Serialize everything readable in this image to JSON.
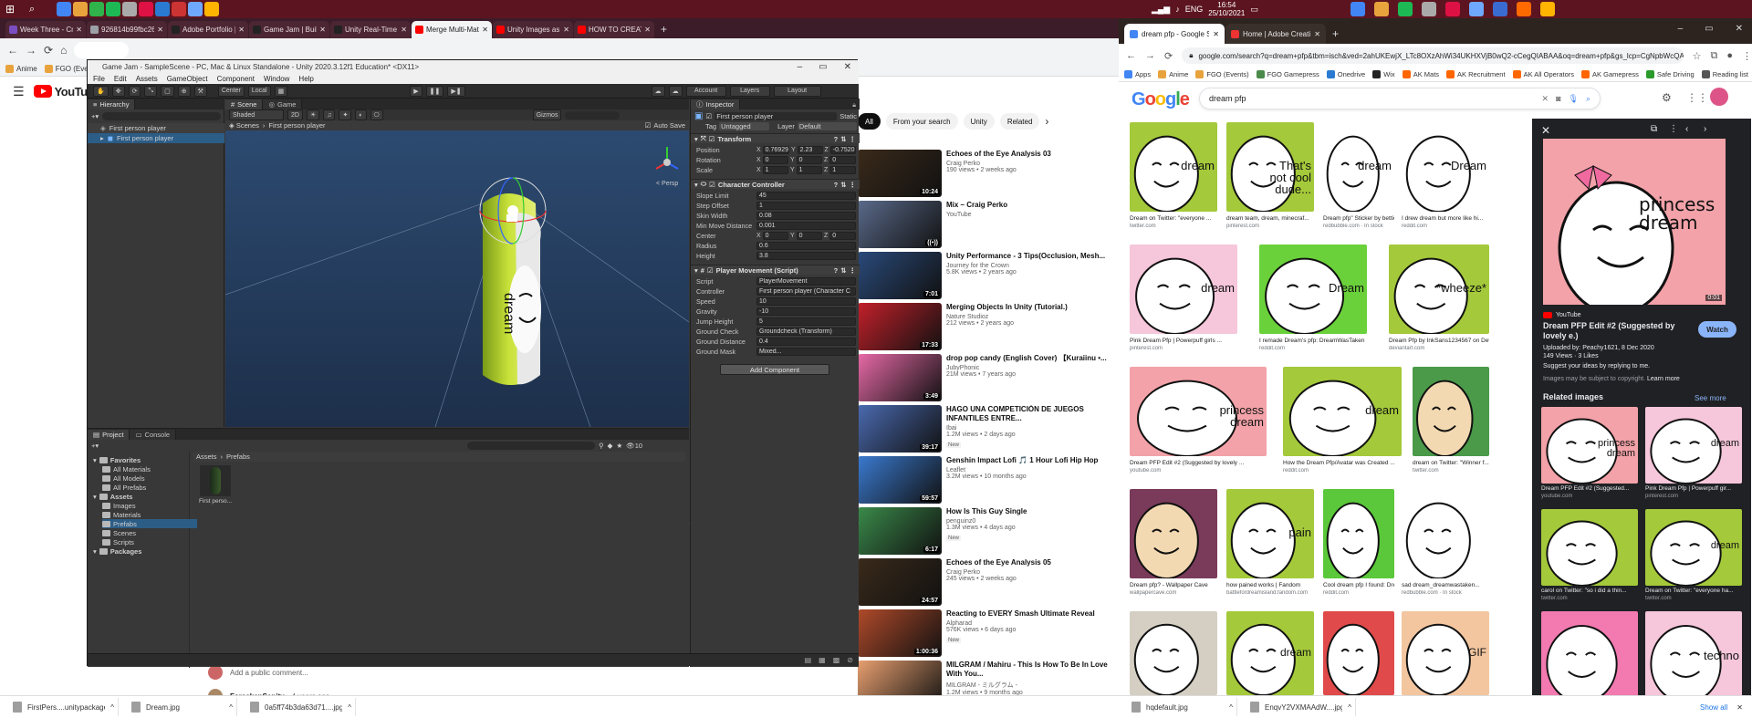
{
  "taskbar": {
    "time": "16:54",
    "date": "25/10/2021",
    "lang": "ENG"
  },
  "left_browser": {
    "tabs": [
      {
        "label": "Week Three - Creating 3D envi",
        "color": "#7a4ec1"
      },
      {
        "label": "926814b99fbc262ec8954b4354",
        "color": "#9aa0a6"
      },
      {
        "label": "Adobe Portfolio | Build your ow",
        "color": "#222"
      },
      {
        "label": "Game Jam | Build History - Clou",
        "color": "#222"
      },
      {
        "label": "Unity Real-Time Development Pl",
        "color": "#222"
      },
      {
        "label": "Merge Multi-Material Meshes in",
        "color": "#f00",
        "active": true
      },
      {
        "label": "Unity Images as Textures and M",
        "color": "#f00"
      },
      {
        "label": "HOW TO CREATE A TRUE MIRRO",
        "color": "#f00"
      }
    ],
    "new_tab": "+",
    "bookmarks": [
      "Anime",
      "FGO (Events)"
    ],
    "downloads": [
      "FirstPers....unitypackage",
      "Dream.jpg",
      "0a5ff74b3da63d71....jpg"
    ]
  },
  "youtube": {
    "logo": "YouTube",
    "chips": [
      "All",
      "From your search",
      "Unity",
      "Related"
    ],
    "chip_next": "›",
    "recommendations": [
      {
        "title": "Echoes of the Eye Analysis 03",
        "channel": "Craig Perko",
        "stats": "190 views • 2 weeks ago",
        "duration": "10:24",
        "color": "#3a2a1a"
      },
      {
        "title": "Mix – Craig Perko",
        "channel": "YouTube",
        "stats": "",
        "duration": "((•))",
        "color": "#5a6a8a"
      },
      {
        "title": "Unity Performance - 3 Tips(Occlusion, Mesh...",
        "channel": "Journey for the Crown",
        "stats": "5.8K views • 2 years ago",
        "duration": "7:01",
        "color": "#2a4a7a"
      },
      {
        "title": "Merging Objects In Unity (Tutorial.)",
        "channel": "Nature Studioz",
        "stats": "212 views • 2 years ago",
        "duration": "17:33",
        "color": "#c2202a"
      },
      {
        "title": "drop pop candy (English Cover) 【Kuraiinu •...",
        "channel": "JubyPhonic",
        "stats": "21M views • 7 years ago",
        "duration": "3:49",
        "color": "#e86aa8"
      },
      {
        "title": "HAGO UNA COMPETICIÓN DE JUEGOS INFANTILES ENTRE...",
        "channel": "Ibai",
        "stats": "1.2M views • 2 days ago",
        "duration": "39:17",
        "color": "#4a6ab0",
        "new": "New"
      },
      {
        "title": "Genshin Impact Lofi 🎵 1 Hour Lofi Hip Hop",
        "channel": "Leaflet",
        "stats": "3.2M views • 10 months ago",
        "duration": "59:57",
        "color": "#3a7ad0"
      },
      {
        "title": "How Is This Guy Single",
        "channel": "penguinz0",
        "stats": "1.3M views • 4 days ago",
        "duration": "6:17",
        "color": "#3a8a4a",
        "new": "New"
      },
      {
        "title": "Echoes of the Eye Analysis 05",
        "channel": "Craig Perko",
        "stats": "245 views • 2 weeks ago",
        "duration": "24:57",
        "color": "#3a2a1a"
      },
      {
        "title": "Reacting to EVERY Smash Ultimate Reveal",
        "channel": "Alpharad",
        "stats": "576K views • 6 days ago",
        "duration": "1:00:36",
        "color": "#b04a2a",
        "new": "New"
      },
      {
        "title": "MILGRAM / Mahiru - This Is How To Be In Love With You...",
        "channel": "MILGRAM - ミルグラム -",
        "stats": "1.2M views • 9 months ago",
        "duration": "",
        "color": "#e8a070"
      }
    ],
    "add_comment": "Add a public comment...",
    "commenter": "ForsakenSanity",
    "comment_time": "4 years ago"
  },
  "unity": {
    "title": "Game Jam - SampleScene - PC, Mac & Linux Standalone - Unity 2020.3.12f1 Education* <DX11>",
    "menu": [
      "File",
      "Edit",
      "Assets",
      "GameObject",
      "Component",
      "Window",
      "Help"
    ],
    "toolbar": {
      "center": "Center",
      "local": "Local",
      "account": "Account",
      "layers": "Layers",
      "layout": "Layout"
    },
    "hierarchy": {
      "tab": "Hierarchy",
      "items": [
        "First person player",
        "First person player"
      ]
    },
    "scene": {
      "tabs": [
        "Scene",
        "Game"
      ],
      "shading": "Shaded",
      "mode2d": "2D",
      "gizmos": "Gizmos",
      "breadcrumb": [
        "Scenes",
        "First person player"
      ],
      "auto_save": "Auto Save",
      "persp": "< Persp",
      "capsule_text": "dream"
    },
    "inspector": {
      "tab": "Inspector",
      "object_name": "First person player",
      "static": "Static",
      "tag_label": "Tag",
      "tag": "Untagged",
      "layer_label": "Layer",
      "layer": "Default",
      "transform": {
        "header": "Transform",
        "position_label": "Position",
        "position": [
          "0.76929",
          "2.23",
          "-0.7520"
        ],
        "rotation_label": "Rotation",
        "rotation": [
          "0",
          "0",
          "0"
        ],
        "scale_label": "Scale",
        "scale": [
          "1",
          "1",
          "1"
        ]
      },
      "cc": {
        "header": "Character Controller",
        "fields": [
          [
            "Slope Limit",
            "45"
          ],
          [
            "Step Offset",
            "1"
          ],
          [
            "Skin Width",
            "0.08"
          ],
          [
            "Min Move Distance",
            "0.001"
          ]
        ],
        "center_label": "Center",
        "center": [
          "0",
          "0",
          "0"
        ],
        "fields2": [
          [
            "Radius",
            "0.6"
          ],
          [
            "Height",
            "3.8"
          ]
        ]
      },
      "pm": {
        "header": "Player Movement (Script)",
        "fields": [
          [
            "Script",
            "PlayerMovement"
          ],
          [
            "Controller",
            "First person player (Character C"
          ],
          [
            "Speed",
            "10"
          ],
          [
            "Gravity",
            "-10"
          ],
          [
            "Jump Height",
            "5"
          ],
          [
            "Ground Check",
            "Groundcheck (Transform)"
          ],
          [
            "Ground Distance",
            "0.4"
          ],
          [
            "Ground Mask",
            "Mixed..."
          ]
        ]
      },
      "add_component": "Add Component"
    },
    "project": {
      "tabs": [
        "Project",
        "Console"
      ],
      "tree": [
        [
          "Favorites",
          0,
          true
        ],
        [
          "All Materials",
          1,
          false
        ],
        [
          "All Models",
          1,
          false
        ],
        [
          "All Prefabs",
          1,
          false
        ],
        [
          "Assets",
          0,
          true
        ],
        [
          "Images",
          1,
          false
        ],
        [
          "Materials",
          1,
          false
        ],
        [
          "Prefabs",
          1,
          false
        ],
        [
          "Scenes",
          1,
          false
        ],
        [
          "Scripts",
          1,
          false
        ],
        [
          "Packages",
          0,
          true
        ]
      ],
      "breadcrumb": [
        "Assets",
        "Prefabs"
      ],
      "asset": "First perso...",
      "count": "10"
    }
  },
  "right_browser": {
    "tabs": [
      {
        "label": "dream pfp - Google Search",
        "active": true
      },
      {
        "label": "Home | Adobe Creative Cloud",
        "active": false
      }
    ],
    "url": "google.com/search?q=dream+pfp&tbm=isch&ved=2ahUKEwjX_LTc8OXzAhWi34UKHXVjB0wQ2-cCegQIABAA&oq=dream+pfp&gs_lcp=CgNpbWcQAzI...",
    "bookmarks": [
      "Apps",
      "Anime",
      "FGO (Events)",
      "FGO Gamepress",
      "Onedrive",
      "Wix",
      "AK Mats",
      "AK Recruitment",
      "AK All Operators",
      "AK Gamepress",
      "Safe Driving",
      "Reading list"
    ],
    "google_logo": "Google",
    "query": "dream pfp",
    "results": [
      {
        "caption": "Dream on Twitter: \"everyone ...",
        "source": "twitter.com",
        "bg": "#a4c93a",
        "text": "dream"
      },
      {
        "caption": "dream team, dream, minecraf...",
        "source": "pinterest.com",
        "bg": "#a4c93a",
        "text": "That's not cool dude..."
      },
      {
        "caption": "Dream pfp\" Sticker by bettie...",
        "source": "redbubble.com · In stock",
        "bg": "#ffffff",
        "text": "dream"
      },
      {
        "caption": "I drew dream but more like hi...",
        "source": "reddit.com",
        "bg": "#ffffff",
        "text": "Dream"
      },
      {
        "caption": "Pink Dream Pfp | Powerpuff girls ...",
        "source": "pinterest.com",
        "bg": "#f6c6da",
        "text": "dream"
      },
      {
        "caption": "I remade Dream's pfp: DreamWasTaken",
        "source": "reddit.com",
        "bg": "#6ad13a",
        "text": "Dream"
      },
      {
        "caption": "Dream Pfp by InkSans1234567 on Devi...",
        "source": "deviantart.com",
        "bg": "#a4c93a",
        "text": "*wheeze*"
      },
      {
        "caption": "Dream PFP Edit #2 (Suggested by lovely ...",
        "source": "youtube.com",
        "bg": "#f2a2a8",
        "text": "princess dream"
      },
      {
        "caption": "How the Dream Pfp/Avatar was Created ...",
        "source": "reddit.com",
        "bg": "#a4c93a",
        "text": "dream"
      },
      {
        "caption": "dream on Twitter: \"Winner f...",
        "source": "twitter.com",
        "bg": "#4a9a4a",
        "text": ""
      },
      {
        "caption": "Dream pfp? - Wallpaper Cave",
        "source": "wallpapercave.com",
        "bg": "#7a3a5a",
        "text": ""
      },
      {
        "caption": "how pained works | Fandom",
        "source": "battlefordreamisland.fandom.com",
        "bg": "#a4c93a",
        "text": "pain"
      },
      {
        "caption": "Cool dream pfp I found: Dream...",
        "source": "reddit.com",
        "bg": "#5ac83a",
        "text": ""
      },
      {
        "caption": "sad dream_dreamwastaken...",
        "source": "redbubble.com · In stock",
        "bg": "#ffffff",
        "text": ""
      },
      {
        "caption": "",
        "source": "",
        "bg": "#d4cfc2",
        "text": ""
      },
      {
        "caption": "",
        "source": "",
        "bg": "#a4c93a",
        "text": "dream"
      },
      {
        "caption": "",
        "source": "",
        "bg": "#e04a4a",
        "text": ""
      },
      {
        "caption": "",
        "source": "",
        "bg": "#f3c6a0",
        "text": "GIF"
      }
    ],
    "preview": {
      "image_text": "princess dream",
      "duration": "0:01",
      "source": "YouTube",
      "title": "Dream PFP Edit #2 (Suggested by lovely e.)",
      "uploaded": "Uploaded by: Peachy1621, 8 Dec 2020",
      "stats": "149 Views · 3 Likes",
      "suggest": "Suggest your ideas by replying to me.",
      "watch": "Watch",
      "copyright": "Images may be subject to copyright.",
      "learn_more": "Learn more",
      "related": "Related images",
      "see_more": "See more",
      "related_items": [
        {
          "caption": "Dream PFP Edit #2 (Suggested...",
          "source": "youtube.com",
          "bg": "#f2a2a8",
          "text": "princess dream"
        },
        {
          "caption": "Pink Dream Pfp | Powerpuff gir...",
          "source": "pinterest.com",
          "bg": "#f6c6da",
          "text": "dream"
        },
        {
          "caption": "carol on Twitter: \"so i did a thin...",
          "source": "twitter.com",
          "bg": "#a4c93a",
          "text": ""
        },
        {
          "caption": "Dream on Twitter: \"everyone ha...",
          "source": "twitter.com",
          "bg": "#a4c93a",
          "text": "dream"
        },
        {
          "caption": "",
          "source": "",
          "bg": "#f27ab0",
          "text": ""
        },
        {
          "caption": "",
          "source": "",
          "bg": "#f6c6da",
          "text": "techno"
        }
      ]
    },
    "downloads": [
      "hqdefault.jpg",
      "EnqvY2VXMAAdW....jpg"
    ],
    "show_all": "Show all"
  }
}
